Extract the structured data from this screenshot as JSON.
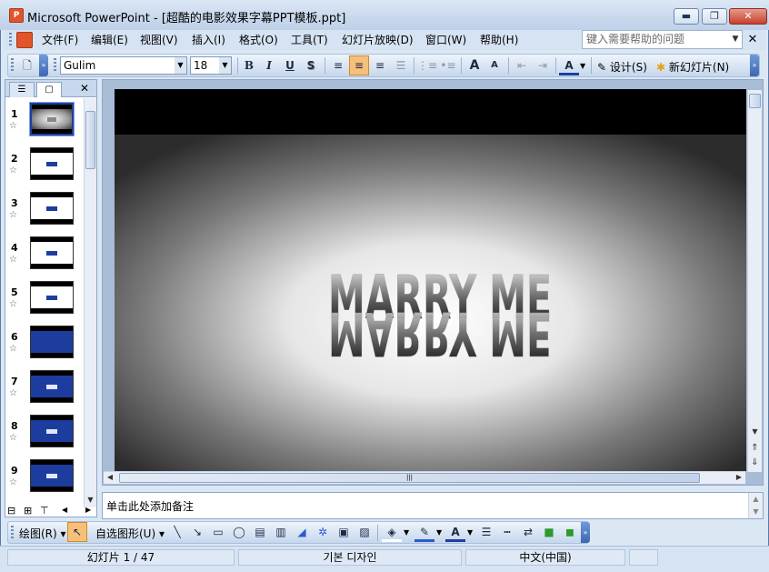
{
  "window": {
    "title": "Microsoft PowerPoint - [超酷的电影效果字幕PPT模板.ppt]"
  },
  "window_controls": {
    "minimize": "▬",
    "restore": "❐",
    "close": "✕"
  },
  "menu": {
    "items": [
      "文件(F)",
      "编辑(E)",
      "视图(V)",
      "插入(I)",
      "格式(O)",
      "工具(T)",
      "幻灯片放映(D)",
      "窗口(W)",
      "帮助(H)"
    ],
    "help_placeholder": "键入需要帮助的问题"
  },
  "toolbar": {
    "font": "Gulim",
    "size": "18",
    "bold": "B",
    "italic": "I",
    "underline": "U",
    "shadow": "S",
    "font_grow": "A",
    "font_shrink": "A",
    "font_color": "A",
    "design_label": "设计(S)",
    "new_slide_label": "新幻灯片(N)"
  },
  "slides_pane": {
    "close": "✕",
    "slides": [
      {
        "num": "1",
        "style": "gray"
      },
      {
        "num": "2",
        "style": "white"
      },
      {
        "num": "3",
        "style": "white"
      },
      {
        "num": "4",
        "style": "white"
      },
      {
        "num": "5",
        "style": "white"
      },
      {
        "num": "6",
        "style": "blue"
      },
      {
        "num": "7",
        "style": "blue"
      },
      {
        "num": "8",
        "style": "blue"
      },
      {
        "num": "9",
        "style": "blue"
      }
    ]
  },
  "slide": {
    "text": "MARRY ME"
  },
  "notes": {
    "placeholder": "单击此处添加备注"
  },
  "drawbar": {
    "draw_label": "绘图(R)",
    "autoshapes_label": "自选图形(U)"
  },
  "status": {
    "slide_info": "幻灯片 1 / 47",
    "design": "기본 디자인",
    "language": "中文(中国)"
  },
  "colors": {
    "accent_blue": "#1d3d9e",
    "title_bar": "#c8d8ec"
  }
}
